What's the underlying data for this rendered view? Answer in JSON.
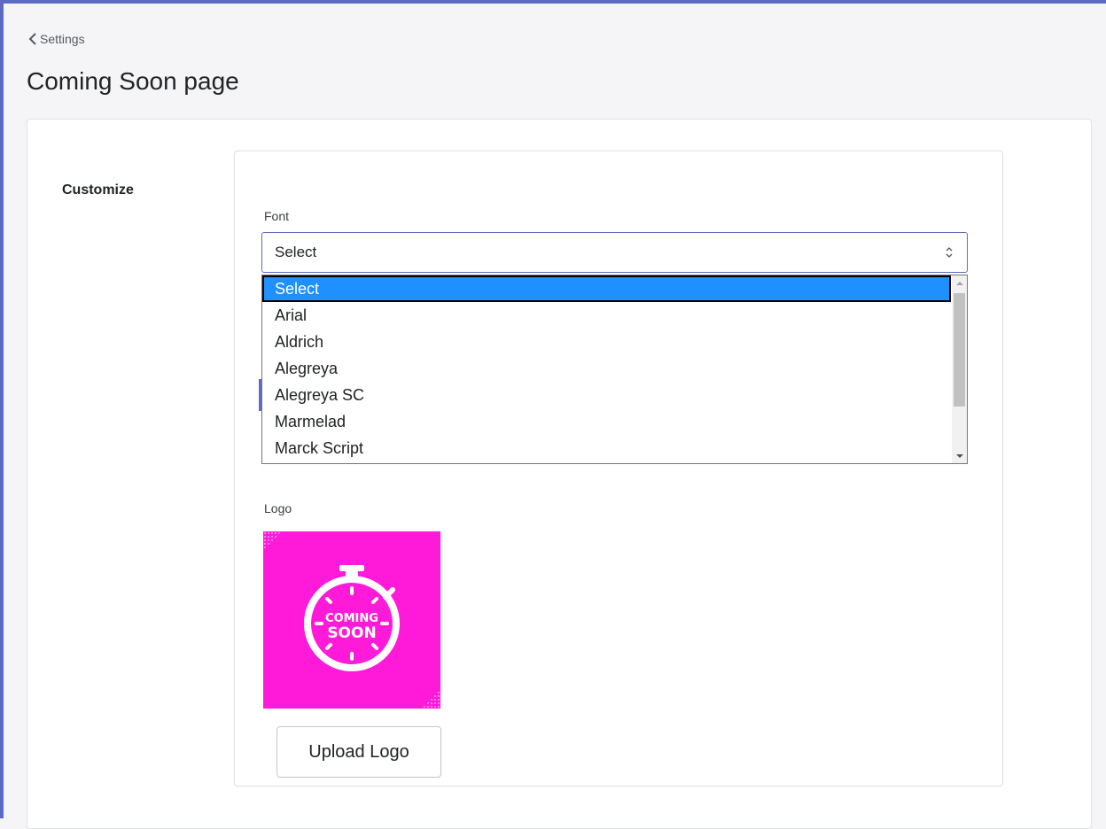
{
  "nav": {
    "back_label": "Settings"
  },
  "page": {
    "title": "Coming Soon page"
  },
  "section": {
    "label": "Customize"
  },
  "font_field": {
    "label": "Font",
    "value": "Select",
    "options": [
      "Select",
      "Arial",
      "Aldrich",
      "Alegreya",
      "Alegreya SC",
      "Marmelad",
      "Marck Script"
    ],
    "selected_index": 0
  },
  "logo_field": {
    "label": "Logo",
    "image_text_line1": "COMING",
    "image_text_line2": "SOON",
    "image_color": "#ff1ad9",
    "upload_label": "Upload Logo"
  },
  "colors": {
    "accent": "#5c6ac4",
    "option_highlight": "#1e90ff"
  }
}
